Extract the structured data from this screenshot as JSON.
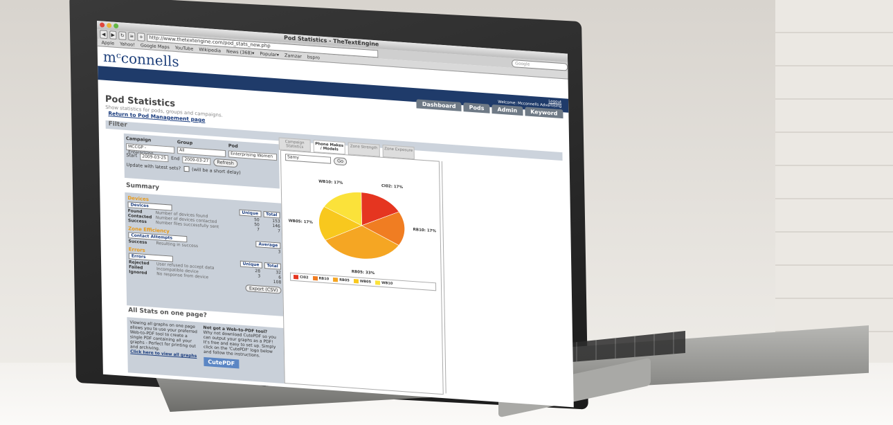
{
  "browser": {
    "window_title": "Pod Statistics - TheTextEngine",
    "url": "http://www.thetextengine.com/pod_stats_new.php",
    "search_placeholder": "Google",
    "bookmarks": [
      "Apple",
      "Yahoo!",
      "Google Maps",
      "YouTube",
      "Wikipedia",
      "News (368)▾",
      "Popular▾",
      "Zamzar",
      "bspro"
    ]
  },
  "brand": {
    "logo_text": "mᶜconnells"
  },
  "header": {
    "logout": "Logout",
    "welcome": "Welcome: Mcconnells Advertising",
    "tabs": [
      "Dashboard",
      "Pods",
      "Admin",
      "Keyword"
    ]
  },
  "page": {
    "title": "Pod Statistics",
    "subtitle": "Show statistics for pods, groups and campaigns.",
    "return_link": "Return to Pod Management page"
  },
  "filter": {
    "heading": "Filter",
    "campaign_label": "Campaign",
    "group_label": "Group",
    "pod_label": "Pod",
    "campaign_value": "MCCGP - Enterprising",
    "group_value": "All",
    "pod_value": "Enterprising Women",
    "start_label": "Start",
    "start_value": "2009-03-25",
    "end_label": "End",
    "end_value": "2009-03-27",
    "refresh_label": "Refresh",
    "update_label": "Update with latest sets?",
    "update_note": "(will be a short delay)"
  },
  "summary": {
    "heading": "Summary",
    "devices_section": "Devices",
    "devices_cols": [
      "Devices",
      "Unique",
      "Total"
    ],
    "devices_rows": [
      {
        "name": "Found",
        "desc": "Number of devices found",
        "unique": "50",
        "total": "153"
      },
      {
        "name": "Contacted",
        "desc": "Number of devices contacted",
        "unique": "50",
        "total": "146"
      },
      {
        "name": "Success",
        "desc": "Number files successfully sent",
        "unique": "7",
        "total": "7"
      }
    ],
    "zone_section": "Zone Efficiency",
    "zone_cols": [
      "Contact Attempts",
      "Average"
    ],
    "zone_rows": [
      {
        "name": "Success",
        "desc": "Resulting in success",
        "value": "3"
      }
    ],
    "errors_section": "Errors",
    "errors_cols": [
      "Errors",
      "Unique",
      "Total"
    ],
    "errors_rows": [
      {
        "name": "Rejected",
        "desc": "User refused to accept data",
        "unique": "28",
        "total": "32"
      },
      {
        "name": "Failed",
        "desc": "Incompatible device",
        "unique": "3",
        "total": "6"
      },
      {
        "name": "Ignored",
        "desc": "No response from device",
        "unique": "",
        "total": "108"
      }
    ],
    "export_label": "Export (CSV)"
  },
  "allstats": {
    "heading": "All Stats on one page?",
    "text": "Viewing all graphs on one page allows you to use your preferred Web-to-PDF tool to create a single PDF containing all your graphs - Perfect for printing out and archiving.",
    "link": "Click here to view all graphs",
    "pdf_heading": "Not got a Web-to-PDF tool?",
    "pdf_text": "Why not download CutePDF so you can output your graphs as a PDF! It's free and easy to set up. Simply click on the 'CutePDF' logo below and follow the instructions.",
    "cutepdf_label": "CutePDF"
  },
  "chart_tabs": [
    "Campaign Statistics",
    "Phone Makes / Models",
    "Zone Strength",
    "Zone Exposure"
  ],
  "chart_controls": {
    "select_value": "Samy",
    "go_label": "Go"
  },
  "chart_data": {
    "type": "pie",
    "categories": [
      "CI02",
      "RB10",
      "RB05",
      "WB05",
      "WB10"
    ],
    "values": [
      17,
      17,
      33,
      17,
      17
    ],
    "labels": [
      "CI02: 17%",
      "RB10: 17%",
      "RB05: 33%",
      "WB05: 17%",
      "WB10: 17%"
    ],
    "colors": [
      "#e53520",
      "#f07d22",
      "#f5a623",
      "#f8c81e",
      "#fbe23a"
    ]
  }
}
